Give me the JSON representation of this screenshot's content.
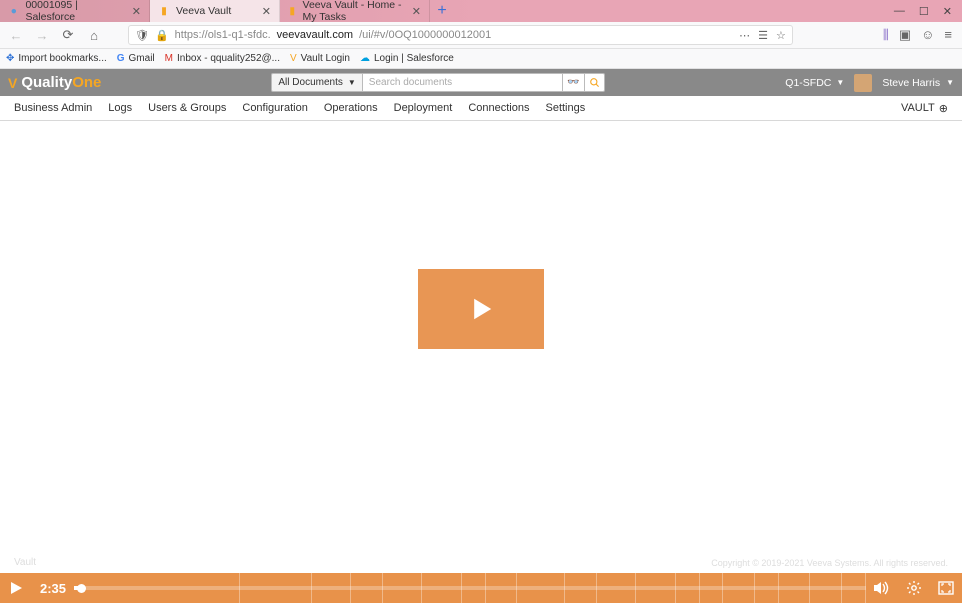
{
  "browser": {
    "tabs": [
      {
        "title": "00001095 | Salesforce",
        "active": false,
        "favicon_color": "#5a9bd8"
      },
      {
        "title": "Veeva Vault",
        "active": true,
        "favicon_color": "#f5a623"
      },
      {
        "title": "Veeva Vault - Home - My Tasks",
        "active": false,
        "favicon_color": "#f5a623"
      }
    ],
    "url_prefix": "https://ols1-q1-sfdc.",
    "url_domain": "veevavault.com",
    "url_path": "/ui/#v/0OQ1000000012001",
    "bookmarks": [
      {
        "label": "Import bookmarks...",
        "icon": "✥",
        "color": "#2a6fd6"
      },
      {
        "label": "Gmail",
        "icon": "G",
        "color": "#4285f4"
      },
      {
        "label": "Inbox - qquality252@...",
        "icon": "M",
        "color": "#d93025"
      },
      {
        "label": "Vault Login",
        "icon": "V",
        "color": "#f5a623"
      },
      {
        "label": "Login | Salesforce",
        "icon": "☁",
        "color": "#00a1e0"
      }
    ]
  },
  "app": {
    "brand_quality": "Quality",
    "brand_one": "One",
    "doc_scope": "All Documents",
    "search_placeholder": "Search documents",
    "env": "Q1-SFDC",
    "user": "Steve Harris",
    "nav": {
      "items": [
        "Business Admin",
        "Logs",
        "Users & Groups",
        "Configuration",
        "Operations",
        "Deployment",
        "Connections",
        "Settings"
      ],
      "right": "VAULT"
    }
  },
  "footer": {
    "left": "Vault",
    "right": "Copyright © 2019-2021 Veeva Systems. All rights reserved."
  },
  "player": {
    "time": "2:35",
    "chapter_widths": [
      21,
      9,
      5,
      4,
      5,
      5,
      3,
      4,
      6,
      4,
      5,
      5,
      3,
      3,
      4,
      3,
      4,
      4,
      3
    ]
  }
}
